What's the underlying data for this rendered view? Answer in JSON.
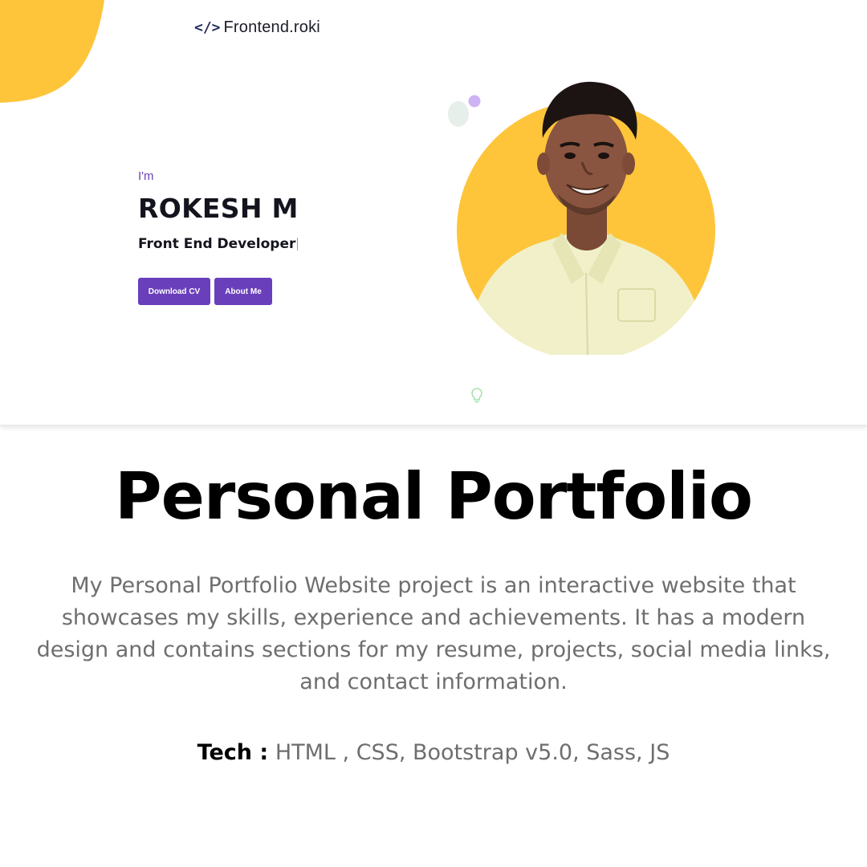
{
  "hero": {
    "logo_code": "</>",
    "logo_text": "Frontend.roki",
    "intro": "I'm",
    "name": "ROKESH M",
    "role": "Front End Developer",
    "buttons": {
      "download_cv": "Download CV",
      "about_me": "About Me"
    },
    "colors": {
      "accent": "#6a3fbc",
      "yellow": "#fec53b",
      "text_dark": "#14141e"
    }
  },
  "caption": {
    "title": "Personal Portfolio",
    "description": "My Personal Portfolio Website project is an interactive website that showcases my skills, experience and achievements. It has a modern design and contains sections for my resume, projects, social media links, and contact information.",
    "tech_label": "Tech :",
    "tech_value": " HTML , CSS, Bootstrap v5.0, Sass, JS"
  },
  "icons": {
    "logo": "code-brackets-icon",
    "bulb": "lightbulb-icon"
  }
}
